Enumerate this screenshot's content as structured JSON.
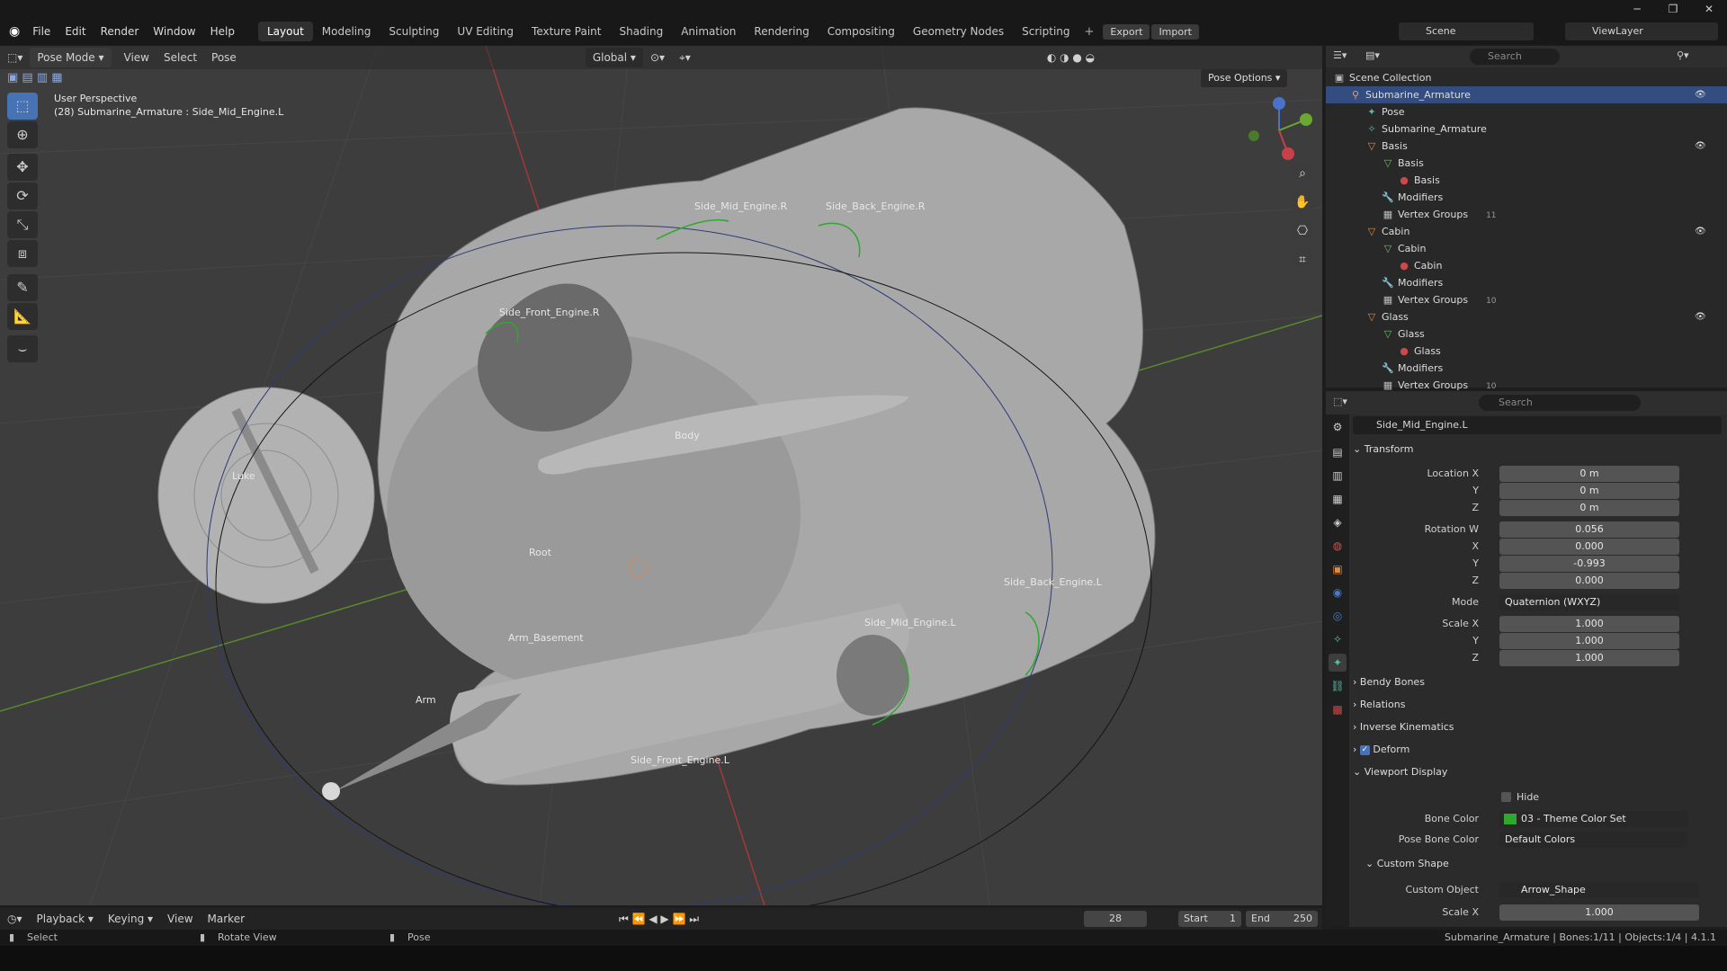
{
  "menu": {
    "file": "File",
    "edit": "Edit",
    "render": "Render",
    "window": "Window",
    "help": "Help"
  },
  "workspaces": [
    "Layout",
    "Modeling",
    "Sculpting",
    "UV Editing",
    "Texture Paint",
    "Shading",
    "Animation",
    "Rendering",
    "Compositing",
    "Geometry Nodes",
    "Scripting"
  ],
  "export_label": "Export",
  "import_label": "Import",
  "scene": "Scene",
  "view_layer": "ViewLayer",
  "viewport": {
    "mode": "Pose Mode",
    "view": "View",
    "select": "Select",
    "pose": "Pose",
    "orientation": "Global",
    "pose_options": "Pose Options",
    "perspective": "User Perspective",
    "context": "(28) Submarine_Armature : Side_Mid_Engine.L",
    "labels": {
      "side_mid_engine_r": "Side_Mid_Engine.R",
      "side_back_engine_r": "Side_Back_Engine.R",
      "side_front_engine_r": "Side_Front_Engine.R",
      "body": "Body",
      "luke": "Luke",
      "root": "Root",
      "side_back_engine_l": "Side_Back_Engine.L",
      "side_mid_engine_l": "Side_Mid_Engine.L",
      "arm_basement": "Arm_Basement",
      "arm": "Arm",
      "side_front_engine_l": "Side_Front_Engine.L"
    }
  },
  "outliner": {
    "search_placeholder": "Search",
    "rows": [
      {
        "label": "Scene Collection",
        "indent": 0,
        "icon": "▣",
        "color": "#bbbbbb"
      },
      {
        "label": "Submarine_Armature",
        "indent": 1,
        "icon": "⚲",
        "color": "#e0a070",
        "selected": true
      },
      {
        "label": "Pose",
        "indent": 2,
        "icon": "✦",
        "color": "#5fb8a8"
      },
      {
        "label": "Submarine_Armature",
        "indent": 2,
        "icon": "✧",
        "color": "#5fb8a8"
      },
      {
        "label": "Basis",
        "indent": 2,
        "icon": "▽",
        "color": "#e08a40"
      },
      {
        "label": "Basis",
        "indent": 3,
        "icon": "▽",
        "color": "#6ac16a"
      },
      {
        "label": "Basis",
        "indent": 4,
        "icon": "●",
        "color": "#c84a4a"
      },
      {
        "label": "Modifiers",
        "indent": 3,
        "icon": "🔧",
        "color": "#6b9bd1"
      },
      {
        "label": "Vertex Groups",
        "indent": 3,
        "icon": "▦",
        "color": "#bbbbbb"
      },
      {
        "label": "Cabin",
        "indent": 2,
        "icon": "▽",
        "color": "#e08a40"
      },
      {
        "label": "Cabin",
        "indent": 3,
        "icon": "▽",
        "color": "#6ac16a"
      },
      {
        "label": "Cabin",
        "indent": 4,
        "icon": "●",
        "color": "#c84a4a"
      },
      {
        "label": "Modifiers",
        "indent": 3,
        "icon": "🔧",
        "color": "#6b9bd1"
      },
      {
        "label": "Vertex Groups",
        "indent": 3,
        "icon": "▦",
        "color": "#bbbbbb"
      },
      {
        "label": "Glass",
        "indent": 2,
        "icon": "▽",
        "color": "#e08a40"
      },
      {
        "label": "Glass",
        "indent": 3,
        "icon": "▽",
        "color": "#6ac16a"
      },
      {
        "label": "Glass",
        "indent": 4,
        "icon": "●",
        "color": "#c84a4a"
      },
      {
        "label": "Modifiers",
        "indent": 3,
        "icon": "🔧",
        "color": "#6b9bd1"
      },
      {
        "label": "Vertex Groups",
        "indent": 3,
        "icon": "▦",
        "color": "#bbbbbb"
      }
    ],
    "vg_counts": {
      "basis": "11",
      "cabin": "10",
      "glass": "10"
    }
  },
  "properties": {
    "search_placeholder": "Search",
    "bone_name": "Side_Mid_Engine.L",
    "transform": "Transform",
    "location_x_lbl": "Location X",
    "y_lbl": "Y",
    "z_lbl": "Z",
    "location": [
      "0 m",
      "0 m",
      "0 m"
    ],
    "rotation_w_lbl": "Rotation W",
    "x_lbl": "X",
    "rotation": [
      "0.056",
      "0.000",
      "-0.993",
      "0.000"
    ],
    "mode_lbl": "Mode",
    "mode": "Quaternion (WXYZ)",
    "scale_x_lbl": "Scale X",
    "scale": [
      "1.000",
      "1.000",
      "1.000"
    ],
    "bendy_bones": "Bendy Bones",
    "relations": "Relations",
    "inverse_kinematics": "Inverse Kinematics",
    "deform": "Deform",
    "viewport_display": "Viewport Display",
    "hide": "Hide",
    "bone_color_lbl": "Bone Color",
    "bone_color": "03 - Theme Color Set",
    "pose_bone_color_lbl": "Pose Bone Color",
    "pose_bone_color": "Default Colors",
    "custom_shape": "Custom Shape",
    "custom_object_lbl": "Custom Object",
    "custom_object": "Arrow_Shape",
    "cs_scale_x_lbl": "Scale X",
    "cs_scale_x": "1.000"
  },
  "timeline": {
    "playback": "Playback",
    "keying": "Keying",
    "view": "View",
    "marker": "Marker",
    "frame": "28",
    "start_lbl": "Start",
    "start": "1",
    "end_lbl": "End",
    "end": "250"
  },
  "status": {
    "select": "Select",
    "rotate_view": "Rotate View",
    "pose": "Pose",
    "info": "Submarine_Armature | Bones:1/11 | Objects:1/4 | 4.1.1"
  },
  "colors": {
    "accent": "#4772b3",
    "selected_row": "#334d80",
    "bone_green": "#2ea82e"
  }
}
